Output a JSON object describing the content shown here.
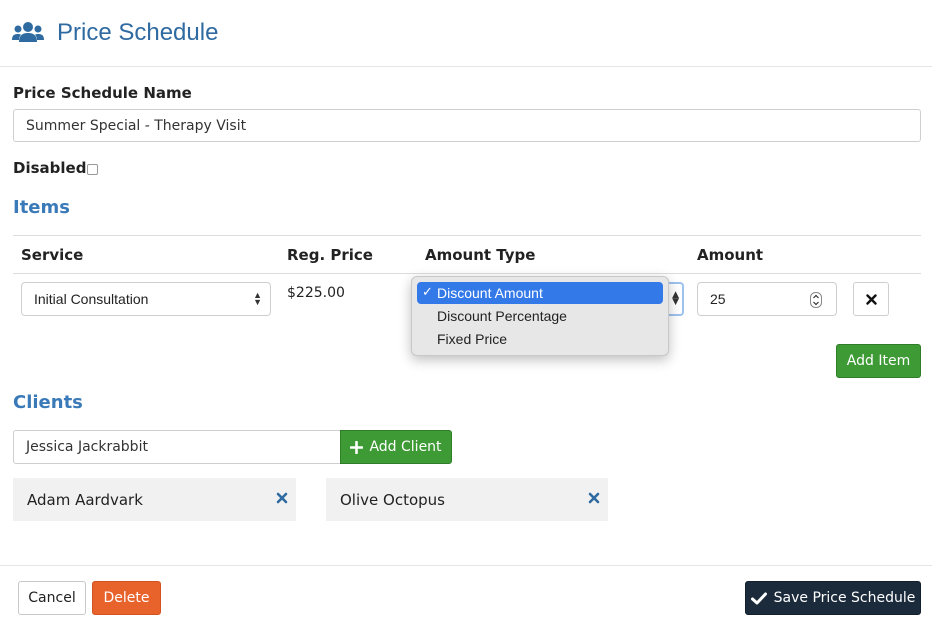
{
  "header": {
    "title": "Price Schedule",
    "icon": "users-icon"
  },
  "form": {
    "name_label": "Price Schedule Name",
    "name_value": "Summer Special - Therapy Visit",
    "disabled_label": "Disabled",
    "disabled_checked": false
  },
  "items": {
    "section_title": "Items",
    "columns": [
      "Service",
      "Reg. Price",
      "Amount Type",
      "Amount"
    ],
    "row": {
      "service": "Initial Consultation",
      "reg_price": "$225.00",
      "amount": "25"
    },
    "amount_type_options": [
      {
        "label": "Discount Amount",
        "selected": true
      },
      {
        "label": "Discount Percentage",
        "selected": false
      },
      {
        "label": "Fixed Price",
        "selected": false
      }
    ],
    "add_item_label": "Add Item"
  },
  "clients": {
    "section_title": "Clients",
    "input_value": "Jessica Jackrabbit",
    "add_client_label": "Add Client",
    "list": [
      "Adam Aardvark",
      "Olive Octopus"
    ]
  },
  "footer": {
    "cancel_label": "Cancel",
    "delete_label": "Delete",
    "save_label": "Save Price Schedule"
  },
  "colors": {
    "title_blue": "#2f6aa1",
    "section_blue": "#3a7ab8",
    "green": "#3e9a35",
    "orange": "#e8622c",
    "navy": "#1b2b3c",
    "select_highlight": "#3479e8",
    "remove_x": "#2f6aa1"
  }
}
